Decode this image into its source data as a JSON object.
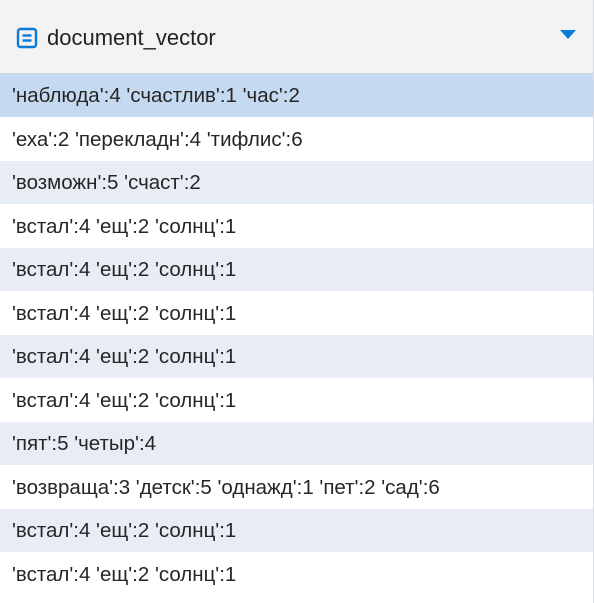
{
  "column": {
    "name": "document_vector",
    "type_icon": "text-column-icon",
    "dropdown_icon": "dropdown-triangle-icon"
  },
  "colors": {
    "accent": "#0a7ad6",
    "header_bg": "#f3f3f3",
    "stripe_bg": "#e8edf5",
    "selected_bg": "#c5daf0"
  },
  "rows": [
    "'наблюда':4 'счастлив':1 'час':2",
    "'еха':2 'перекладн':4 'тифлис':6",
    "'возможн':5 'счаст':2",
    "'встал':4 'ещ':2 'солнц':1",
    "'встал':4 'ещ':2 'солнц':1",
    "'встал':4 'ещ':2 'солнц':1",
    "'встал':4 'ещ':2 'солнц':1",
    "'встал':4 'ещ':2 'солнц':1",
    "'пят':5 'четыр':4",
    "'возвраща':3 'детск':5 'однажд':1 'пет':2 'сад':6",
    "'встал':4 'ещ':2 'солнц':1",
    "'встал':4 'ещ':2 'солнц':1"
  ],
  "selected_row": 0
}
